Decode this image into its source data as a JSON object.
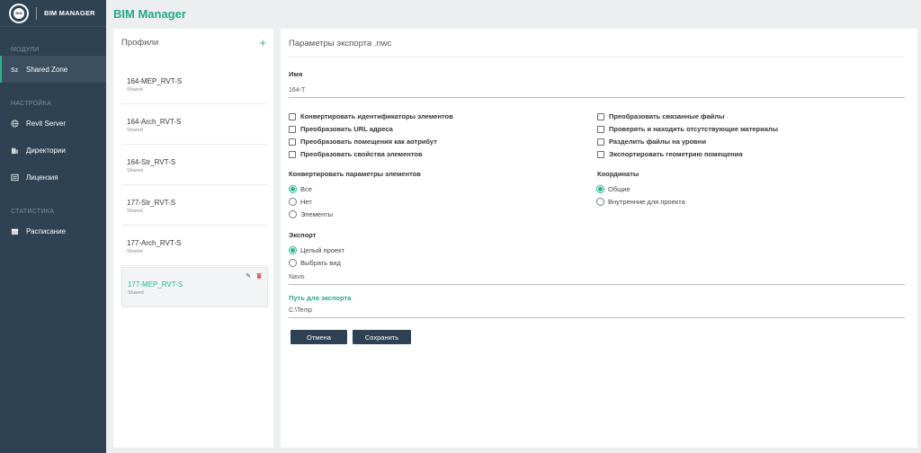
{
  "brand": {
    "logo_mark": "BIM",
    "name": "BIM MANAGER"
  },
  "app_title": "BIM Manager",
  "sidebar": {
    "sections": [
      {
        "label": "МОДУЛИ",
        "items": [
          {
            "label": "Shared Zone",
            "icon": "shared-zone-icon",
            "active": true
          }
        ]
      },
      {
        "label": "НАСТРОЙКА",
        "items": [
          {
            "label": "Revit Server",
            "icon": "globe-icon"
          },
          {
            "label": "Директории",
            "icon": "building-icon"
          },
          {
            "label": "Лицензия",
            "icon": "license-icon"
          }
        ]
      },
      {
        "label": "СТАТИСТИКА",
        "items": [
          {
            "label": "Расписание",
            "icon": "calendar-icon"
          }
        ]
      }
    ]
  },
  "profiles": {
    "title": "Профили",
    "items": [
      {
        "name": "164-MEP_RVT-S",
        "sub": "Shared"
      },
      {
        "name": "164-Arch_RVT-S",
        "sub": "Shared"
      },
      {
        "name": "164-Str_RVT-S",
        "sub": "Shared"
      },
      {
        "name": "177-Str_RVT-S",
        "sub": "Shared"
      },
      {
        "name": "177-Arch_RVT-S",
        "sub": "Shared"
      },
      {
        "name": "177-MEP_RVT-S",
        "sub": "Shared",
        "selected": true
      }
    ]
  },
  "settings": {
    "title": "Параметры экспорта .nwc",
    "name_label": "Имя",
    "name_value": "164-T",
    "checkboxes_left": [
      "Конвертировать идентификаторы элементов",
      "Преобразовать URL адреса",
      "Преобразовать помещения как аотрибут",
      "Преобразовать свойства элементов"
    ],
    "checkboxes_right": [
      "Преобразовать связанные файлы",
      "Проверять и находить отсутствующие материалы",
      "Разделить файлы на уровни",
      "Экспортировать геометрию помещения"
    ],
    "element_params": {
      "label": "Конвертировать параметры элементов",
      "options": [
        "Все",
        "Нет",
        "Элементы"
      ],
      "selected": 0
    },
    "coordinates": {
      "label": "Координаты",
      "options": [
        "Общие",
        "Внутренние для проекта"
      ],
      "selected": 0
    },
    "export": {
      "label": "Экспорт",
      "options": [
        "Целый проект",
        "Выбрать вид"
      ],
      "selected": 0,
      "view_value": "Navis"
    },
    "export_path": {
      "label": "Путь для экспорта",
      "value": "C:\\Temp"
    },
    "buttons": {
      "cancel": "Отмена",
      "save": "Сохранить"
    }
  },
  "colors": {
    "sidebar": "#2f4253",
    "accent": "#26b58e",
    "title": "#26a888",
    "danger": "#e0584b"
  }
}
